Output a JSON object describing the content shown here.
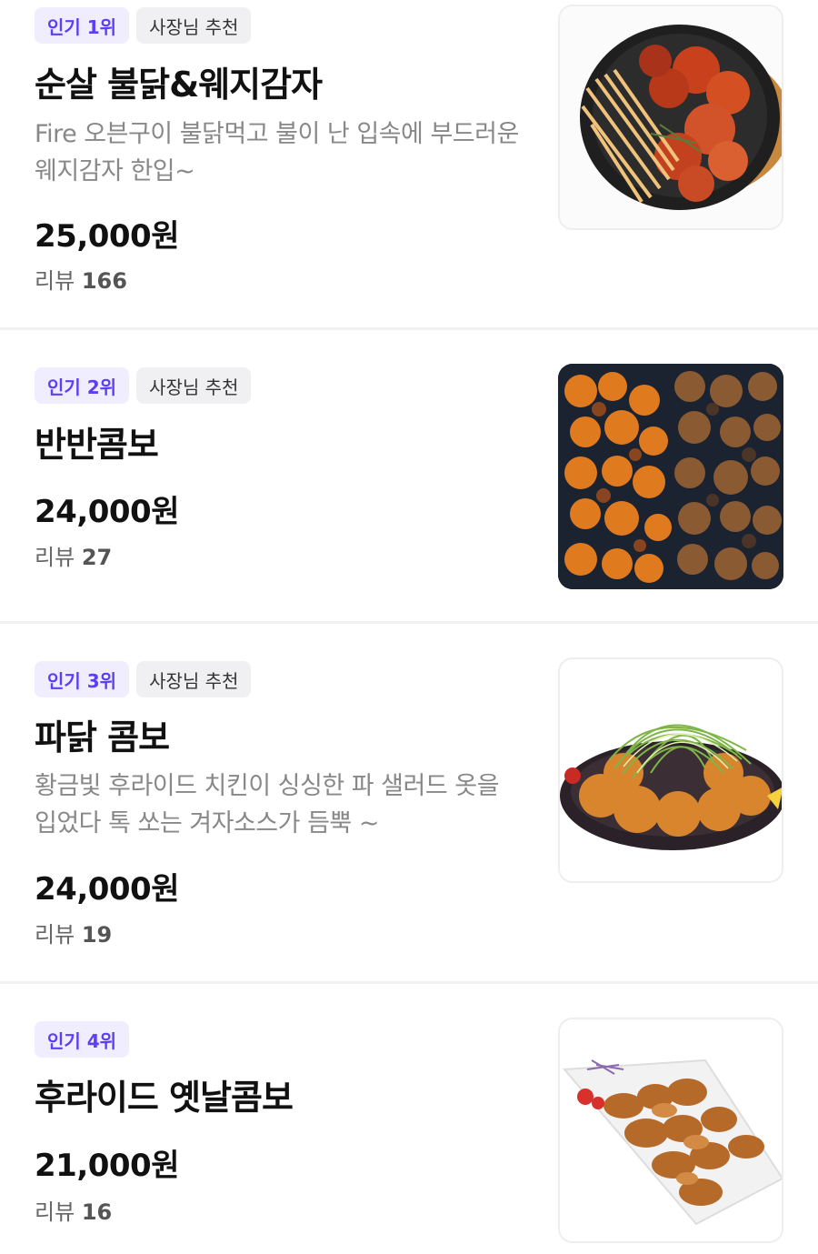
{
  "menu_items": [
    {
      "rank_badge": "인기 1위",
      "owner_badge": "사장님 추천",
      "name": "순살 불닭&웨지감자",
      "description": "Fire 오븐구이 불닭먹고 불이 난 입속에 부드러운 웨지감자 한입~",
      "price": "25,000원",
      "reviews_label": "리뷰",
      "reviews_count": "166",
      "image_icon": "spicy-chicken-wedge-fries-photo"
    },
    {
      "rank_badge": "인기 2위",
      "owner_badge": "사장님 추천",
      "name": "반반콤보",
      "description": "",
      "price": "24,000원",
      "reviews_label": "리뷰",
      "reviews_count": "27",
      "image_icon": "half-half-chicken-photo"
    },
    {
      "rank_badge": "인기 3위",
      "owner_badge": "사장님 추천",
      "name": "파닭 콤보",
      "description": "황금빛 후라이드 치킨이 싱싱한 파 샐러드 옷을 입었다 톡 쏘는 겨자소스가 듬뿍 ~",
      "price": "24,000원",
      "reviews_label": "리뷰",
      "reviews_count": "19",
      "image_icon": "green-onion-chicken-photo"
    },
    {
      "rank_badge": "인기 4위",
      "owner_badge": "",
      "name": "후라이드 옛날콤보",
      "description": "",
      "price": "21,000원",
      "reviews_label": "리뷰",
      "reviews_count": "16",
      "image_icon": "fried-chicken-platter-photo"
    }
  ],
  "colors": {
    "rank_badge_text": "#5b3ff5",
    "rank_badge_bg": "#f0edff",
    "owner_badge_bg": "#f0f0f2",
    "description_text": "#888888",
    "divider": "#f1f1f3"
  }
}
